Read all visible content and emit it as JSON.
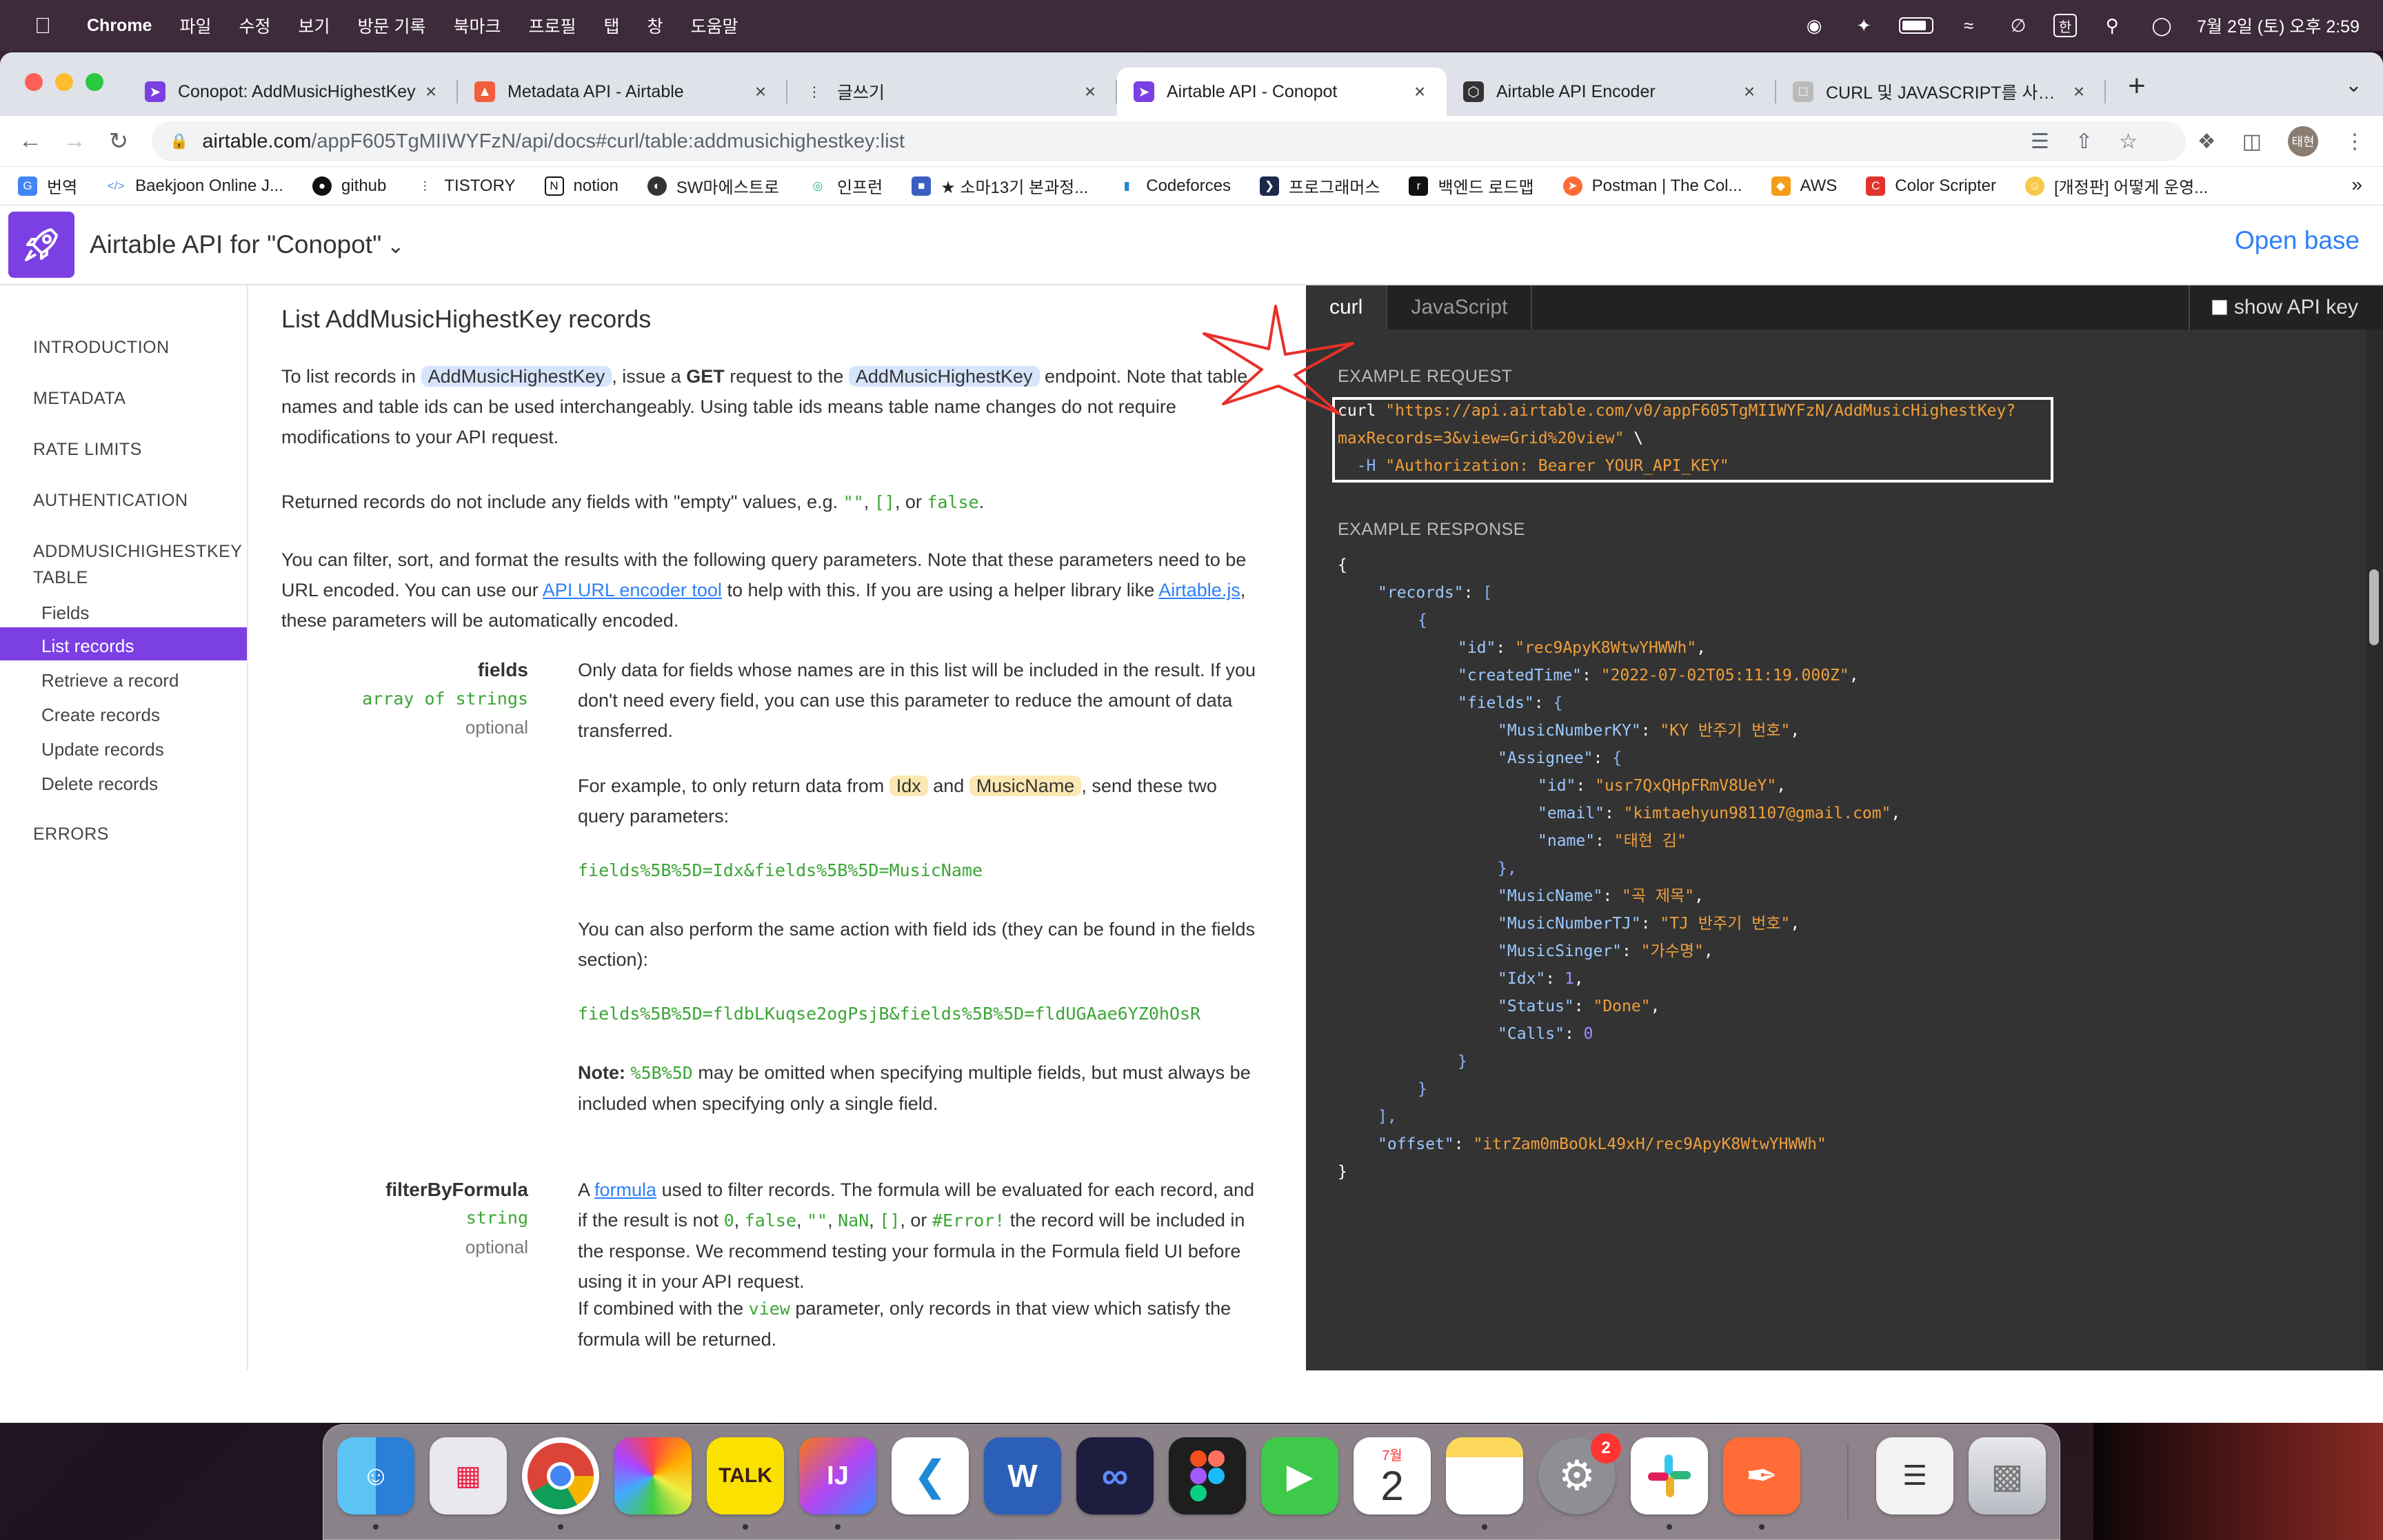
{
  "menubar": {
    "app": "Chrome",
    "items": [
      "파일",
      "수정",
      "보기",
      "방문 기록",
      "북마크",
      "프로필",
      "탭",
      "창",
      "도움말"
    ],
    "clock": "7월 2일 (토) 오후 2:59",
    "input_lang": "한"
  },
  "tabs": [
    {
      "title": "Conopot: AddMusicHighestKey",
      "close": "×",
      "color": "#7b3fe4",
      "icon": "airtable-rocket-icon"
    },
    {
      "title": "Metadata API - Airtable",
      "close": "×",
      "color": "#f25e3d",
      "icon": "airtable-logo-icon"
    },
    {
      "title": "글쓰기",
      "close": "×",
      "color": "#444444",
      "icon": "dots-icon"
    },
    {
      "title": "Airtable API - Conopot",
      "close": "×",
      "color": "#7b3fe4",
      "icon": "airtable-rocket-icon"
    },
    {
      "title": "Airtable API Encoder",
      "close": "×",
      "color": "#333333",
      "icon": "codepen-icon"
    },
    {
      "title": "CURL 및 JAVASCRIPT를 사용한 A",
      "close": "×",
      "color": "#888888",
      "icon": "page-icon"
    }
  ],
  "new_tab": "+",
  "address": {
    "host": "airtable.com",
    "path": "/appF605TgMIIWYFzN/api/docs#curl/table:addmusichighestkey:list"
  },
  "profile_initials": "태현",
  "bookmarks": [
    {
      "label": "번역",
      "color": "#4285f4"
    },
    {
      "label": "Baekjoon Online J...",
      "color": "#5a8fd8"
    },
    {
      "label": "github",
      "color": "#111111"
    },
    {
      "label": "TISTORY",
      "color": "#333333"
    },
    {
      "label": "notion",
      "color": "#222222"
    },
    {
      "label": "SW마에스트로",
      "color": "#333333"
    },
    {
      "label": "인프런",
      "color": "#1dc078"
    },
    {
      "label": "★ 소마13기 본과정...",
      "color": "#3b5fc0"
    },
    {
      "label": "Codeforces",
      "color": "#1f8acb"
    },
    {
      "label": "프로그래머스",
      "color": "#1b2a4a"
    },
    {
      "label": "백엔드 로드맵",
      "color": "#111111"
    },
    {
      "label": "Postman | The Col...",
      "color": "#ff6c37"
    },
    {
      "label": "AWS",
      "color": "#f59c1b"
    },
    {
      "label": "Color Scripter",
      "color": "#e2342e"
    },
    {
      "label": "[개정판] 어떻게 운영...",
      "color": "#f7c948"
    }
  ],
  "bookmarks_more": "»",
  "header": {
    "title": "Airtable API for \"Conopot\"",
    "open_base": "Open base"
  },
  "sidebar": {
    "introduction": "INTRODUCTION",
    "metadata": "METADATA",
    "rate_limits": "RATE LIMITS",
    "authentication": "AUTHENTICATION",
    "table_line1": "ADDMUSICHIGHESTKEY",
    "table_line2": "TABLE",
    "fields": "Fields",
    "list_records": "List records",
    "retrieve": "Retrieve a record",
    "create": "Create records",
    "update": "Update records",
    "delete": "Delete records",
    "errors": "ERRORS"
  },
  "content": {
    "heading": "List AddMusicHighestKey records",
    "p1_a": "To list records in ",
    "table_chip": "AddMusicHighestKey",
    "p1_b": ", issue a ",
    "p1_get": "GET",
    "p1_c": " request to the ",
    "p1_d": " endpoint. Note that table names and table ids can be used interchangeably. Using table ids means table name changes do not require modifications to your API request.",
    "p2_a": "Returned records do not include any fields with \"empty\" values, e.g. ",
    "empty_str": "\"\"",
    "empty_arr": "[]",
    "p2_or": ", or ",
    "false_val": "false",
    "p2_end": ".",
    "p3_a": "You can filter, sort, and format the results with the following query parameters. Note that these parameters need to be URL encoded. You can use our ",
    "encoder_link": "API URL encoder tool",
    "p3_b": " to help with this. If you are using a helper library like ",
    "airtablejs_link": "Airtable.js",
    "p3_c": ", these parameters will be automatically encoded.",
    "fields_param": {
      "name": "fields",
      "type": "array of strings",
      "optional": "optional",
      "desc1": "Only data for fields whose names are in this list will be included in the result. If you don't need every field, you can use this parameter to reduce the amount of data transferred.",
      "desc2_a": "For example, to only return data from ",
      "chip_idx": "Idx",
      "desc2_and": " and ",
      "chip_music": "MusicName",
      "desc2_b": ", send these two query parameters:",
      "code1": "fields%5B%5D=Idx&fields%5B%5D=MusicName",
      "desc3": "You can also perform the same action with field ids (they can be found in the fields section):",
      "code2": "fields%5B%5D=fldbLKuqse2ogPsjB&fields%5B%5D=fldUGAae6YZ0hOsR",
      "note_label": "Note:",
      "note_code": "%5B%5D",
      "note_text": " may be omitted when specifying multiple fields, but must always be included when specifying only a single field."
    },
    "filter_param": {
      "name": "filterByFormula",
      "type": "string",
      "optional": "optional",
      "d1_a": "A ",
      "formula_link": "formula",
      "d1_b": " used to filter records. The formula will be evaluated for each record, and if the result is not ",
      "zero": "0",
      "comma": ", ",
      "false_val": "false",
      "empty_str": "\"\"",
      "nan": "NaN",
      "empty_arr": "[]",
      "or": ", or ",
      "error": "#Error!",
      "d1_c": " the record will be included in the response. We recommend testing your formula in the Formula field UI before using it in your API request.",
      "d2_a": "If combined with the ",
      "view_code": "view",
      "d2_b": " parameter, only records in that view which satisfy the formula will be returned."
    }
  },
  "codepanel": {
    "tab_curl": "curl",
    "tab_js": "JavaScript",
    "show_key": "show API key",
    "example_request": "EXAMPLE REQUEST",
    "example_response": "EXAMPLE RESPONSE",
    "req": {
      "curl": "curl ",
      "url1": "\"https://api.airtable.com/v0/appF605TgMIIWYFzN/AddMusicHighestKey?",
      "url2": "maxRecords=3&view=Grid%20view\"",
      "backslash": " \\",
      "flag": "  -H ",
      "auth": "\"Authorization: Bearer YOUR_API_KEY\""
    },
    "resp": {
      "open": "{",
      "records_key": "\"records\"",
      "colon": ": ",
      "bracket_open": "[",
      "obj_open": "{",
      "id_key": "\"id\"",
      "id_val": "\"rec9ApyK8WtwYHWWh\"",
      "created_key": "\"createdTime\"",
      "created_val": "\"2022-07-02T05:11:19.000Z\"",
      "fields_key": "\"fields\"",
      "mnky_key": "\"MusicNumberKY\"",
      "mnky_val": "\"KY 반주기 번호\"",
      "assignee_key": "\"Assignee\"",
      "a_id_key": "\"id\"",
      "a_id_val": "\"usr7QxQHpFRmV8UeY\"",
      "a_email_key": "\"email\"",
      "a_email_val": "\"kimtaehyun981107@gmail.com\"",
      "a_name_key": "\"name\"",
      "a_name_val": "\"태현 김\"",
      "close_brace_comma": "},",
      "mname_key": "\"MusicName\"",
      "mname_val": "\"곡 제목\"",
      "mntj_key": "\"MusicNumberTJ\"",
      "mntj_val": "\"TJ 반주기 번호\"",
      "msinger_key": "\"MusicSinger\"",
      "msinger_val": "\"가수명\"",
      "idx_key": "\"Idx\"",
      "idx_val": "1",
      "status_key": "\"Status\"",
      "status_val": "\"Done\"",
      "calls_key": "\"Calls\"",
      "calls_val": "0",
      "comma": ",",
      "close_brace": "}",
      "close_bracket": "],",
      "offset_key": "\"offset\"",
      "offset_val": "\"itrZam0mBoOkL49xH/rec9ApyK8WtwYHWWh\"",
      "close": "}"
    }
  },
  "dock": {
    "calendar_month": "7월",
    "calendar_day": "2",
    "settings_badge": "2",
    "kakao_label": "TALK",
    "ij_label": "IJ"
  }
}
